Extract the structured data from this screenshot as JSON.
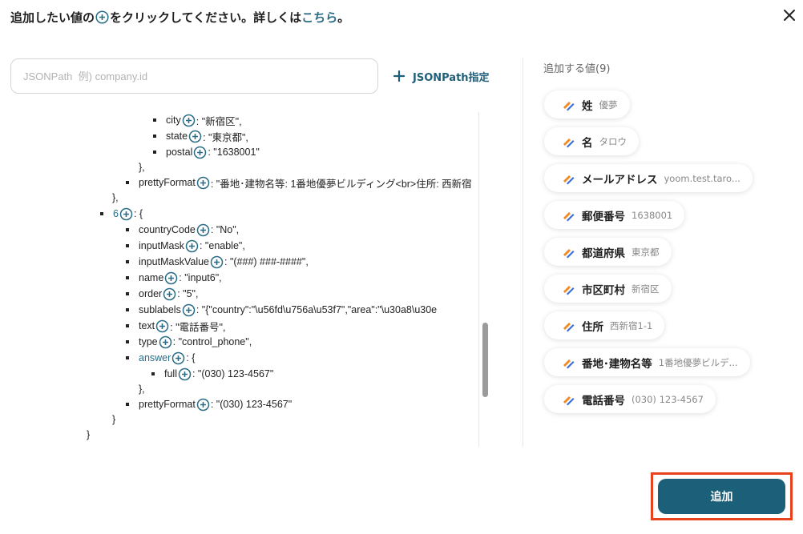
{
  "header": {
    "title_before": "追加したい値の",
    "title_after": "をクリックしてください。詳しくは",
    "link_text": "こちら",
    "title_end": "。"
  },
  "search": {
    "placeholder": "JSONPath  例) company.id"
  },
  "jsonpath_button": {
    "label": "JSONPath指定"
  },
  "tree": {
    "city_key": "city",
    "city_val": ": \"新宿区\",",
    "state_key": "state",
    "state_val": ": \"東京都\",",
    "postal_key": "postal",
    "postal_val": ": \"1638001\"",
    "close_brace_comma_1": "},",
    "pretty1_key": "prettyFormat",
    "pretty1_val": ": \"番地･建物名等: 1番地優夢ビルディング<br>住所: 西新宿",
    "close_brace_comma_2": "},",
    "item6_key": "6",
    "item6_val": ": {",
    "countryCode_key": "countryCode",
    "countryCode_val": ": \"No\",",
    "inputMask_key": "inputMask",
    "inputMask_val": ": \"enable\",",
    "inputMaskValue_key": "inputMaskValue",
    "inputMaskValue_val": ": \"(###) ###-####\",",
    "name_key": "name",
    "name_val": ": \"input6\",",
    "order_key": "order",
    "order_val": ": \"5\",",
    "sublabels_key": "sublabels",
    "sublabels_val": ": \"{\"country\":\"\\u56fd\\u756a\\u53f7\",\"area\":\"\\u30a8\\u30e",
    "text_key": "text",
    "text_val": ": \"電話番号\",",
    "type_key": "type",
    "type_val": ": \"control_phone\",",
    "answer_key": "answer",
    "answer_val": ": {",
    "full_key": "full",
    "full_val": ": \"(030) 123-4567\"",
    "close_brace_comma_3": "},",
    "pretty2_key": "prettyFormat",
    "pretty2_val": ": \"(030) 123-4567\"",
    "close_brace_4": "}",
    "close_brace_5": "}"
  },
  "values_panel": {
    "title": "追加する値(9)",
    "items": [
      {
        "label": "姓",
        "value": "優夢"
      },
      {
        "label": "名",
        "value": "タロウ"
      },
      {
        "label": "メールアドレス",
        "value": "yoom.test.taro..."
      },
      {
        "label": "郵便番号",
        "value": "1638001"
      },
      {
        "label": "都道府県",
        "value": "東京都"
      },
      {
        "label": "市区町村",
        "value": "新宿区"
      },
      {
        "label": "住所",
        "value": "西新宿1-1"
      },
      {
        "label": "番地･建物名等",
        "value": "1番地優夢ビルデ..."
      },
      {
        "label": "電話番号",
        "value": "(030) 123-4567"
      }
    ]
  },
  "add_button": {
    "label": "追加"
  },
  "colors": {
    "accent": "#1b5f78",
    "link": "#2a6c86",
    "highlight": "#e8411e"
  },
  "icons": {
    "close": "close-icon",
    "plus": "plus-circle-icon",
    "chip": "pencil-icon"
  }
}
